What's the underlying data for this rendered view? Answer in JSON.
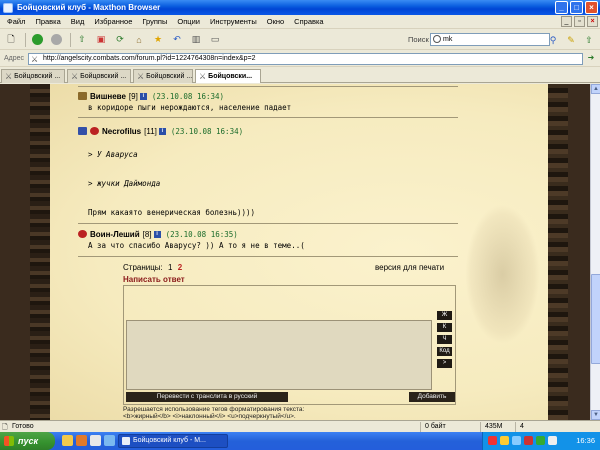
{
  "window": {
    "title": "Бойцовский клуб - Maxthon Browser"
  },
  "menu": [
    "Файл",
    "Правка",
    "Вид",
    "Избранное",
    "Группы",
    "Опции",
    "Инструменты",
    "Окно",
    "Справка"
  ],
  "search": {
    "label": "Поиск",
    "value": "mk"
  },
  "address": {
    "label": "Адрес",
    "url": "http://angelscity.combats.com/forum.pl?id=1224764308n=index&p=2"
  },
  "tabs": [
    {
      "label": "Бойцовский ..."
    },
    {
      "label": "Бойцовский ..."
    },
    {
      "label": "Бойцовский ..."
    },
    {
      "label": "Бойцовски..."
    }
  ],
  "posts": [
    {
      "nick": "Вишневе",
      "level": "[9]",
      "date": "(23.10.08 16:34)",
      "lines": [
        "в коридоре пыги нерождаются, население падает"
      ]
    },
    {
      "nick": "Necrofilus",
      "level": "[11]",
      "date": "(23.10.08 16:34)",
      "lines": [
        "> У Аваруса",
        "> жучки Даймонда",
        "Прям какаято венерическая болезнь))))"
      ]
    },
    {
      "nick": "Воин-Леший",
      "level": "[8]",
      "date": "(23.10.08 16:35)",
      "lines": [
        "А за что спасибо Аварусу? )) А то я не в теме..("
      ]
    }
  ],
  "pagination": {
    "label": "Страницы:",
    "pages": [
      "1",
      "2"
    ],
    "current": "2"
  },
  "print_version": "версия для печати",
  "reply": {
    "title": "Написать ответ",
    "format_buttons": [
      "Ж",
      "К",
      "Ч",
      "Код",
      ">"
    ],
    "translit_button": "Перевести с транслита в русский",
    "submit_button": "Добавить",
    "tags_note_1": "Разрешается использование тегов форматирования текста:",
    "tags_note_2": "<b>жирный</b> <i>наклонный</i> <u>подчеркнутый</u>."
  },
  "status": {
    "text": "Готово",
    "c1": "0 байт",
    "c2": "435M",
    "c3": "4"
  },
  "taskbar": {
    "start": "пуск",
    "item": "Бойцовский клуб - M...",
    "clock": "16:36"
  }
}
